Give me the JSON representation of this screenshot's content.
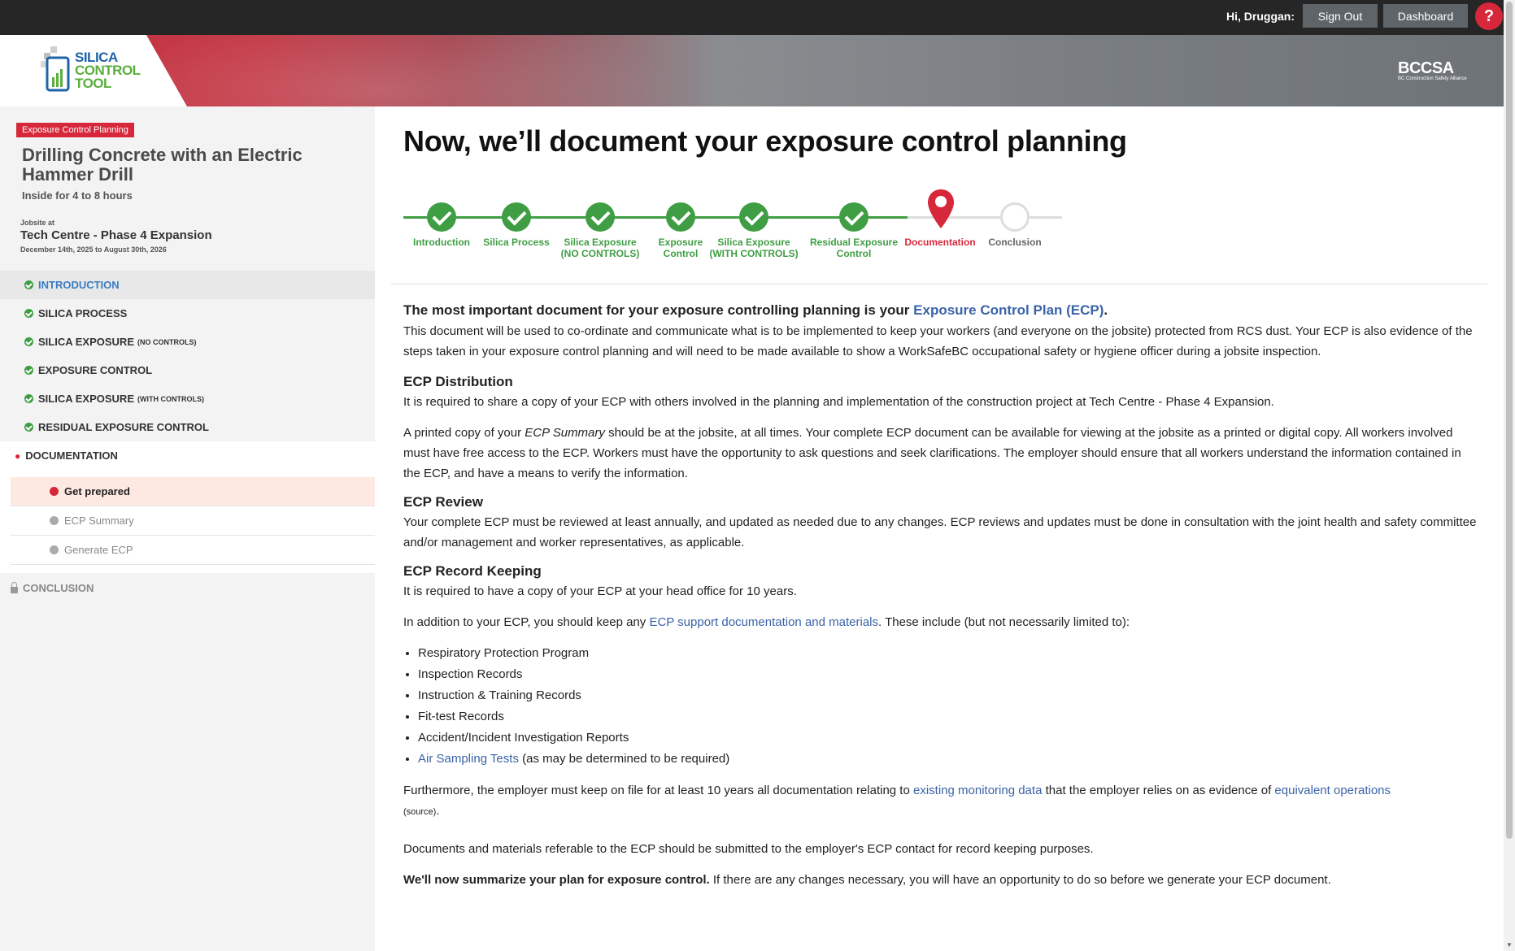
{
  "topbar": {
    "greeting": "Hi, Druggan:",
    "sign_out": "Sign Out",
    "dashboard": "Dashboard",
    "help": "?"
  },
  "banner": {
    "logo_line1": "SILICA",
    "logo_line2": "CONTROL",
    "logo_line3": "TOOL",
    "partner": "BCCSA",
    "partner_sub": "BC Construction Safety Alliance"
  },
  "sidebar": {
    "badge": "Exposure Control Planning",
    "task_title": "Drilling Concrete with an Electric Hammer Drill",
    "task_duration": "Inside for 4 to 8 hours",
    "jobsite_label": "Jobsite at",
    "jobsite_name": "Tech Centre - Phase 4 Expansion",
    "jobsite_dates": "December 14th, 2025 to August 30th, 2026",
    "nav": [
      {
        "label": "Introduction",
        "small": ""
      },
      {
        "label": "Silica Process",
        "small": ""
      },
      {
        "label": "Silica Exposure",
        "small": "(NO CONTROLS)"
      },
      {
        "label": "Exposure Control",
        "small": ""
      },
      {
        "label": "Silica Exposure",
        "small": "(WITH CONTROLS)"
      },
      {
        "label": "Residual Exposure Control",
        "small": ""
      },
      {
        "label": "Documentation",
        "small": ""
      },
      {
        "label": "Conclusion",
        "small": ""
      }
    ],
    "sub_items": [
      "Get prepared",
      "ECP Summary",
      "Generate ECP"
    ]
  },
  "main": {
    "heading": "Now, we’ll document your exposure control planning",
    "steps": [
      {
        "l1": "Introduction",
        "l2": ""
      },
      {
        "l1": "Silica Process",
        "l2": ""
      },
      {
        "l1": "Silica Exposure",
        "l2": "(NO CONTROLS)"
      },
      {
        "l1": "Exposure",
        "l2": "Control"
      },
      {
        "l1": "Silica Exposure",
        "l2": "(WITH CONTROLS)"
      },
      {
        "l1": "Residual Exposure",
        "l2": "Control"
      },
      {
        "l1": "Documentation",
        "l2": ""
      },
      {
        "l1": "Conclusion",
        "l2": ""
      }
    ],
    "intro_heading_pre": "The most important document for your exposure controlling planning is your ",
    "intro_heading_link": "Exposure Control Plan (ECP)",
    "intro_heading_post": ".",
    "intro_para": "This document will be used to co-ordinate and communicate what is to be implemented to keep your workers (and everyone on the jobsite) protected from RCS dust. Your ECP is also evidence of the steps taken in your exposure control planning and will need to be made available to show a WorkSafeBC occupational safety or hygiene officer during a jobsite inspection.",
    "dist_heading": "ECP Distribution",
    "dist_p1": "It is required to share a copy of your ECP with others involved in the planning and implementation of the construction project at Tech Centre - Phase 4 Expansion.",
    "dist_p2_pre": "A printed copy of your ",
    "dist_p2_em": "ECP Summary",
    "dist_p2_post": " should be at the jobsite, at all times. Your complete ECP document can be available for viewing at the jobsite as a printed or digital copy. All workers involved must have free access to the ECP. Workers must have the opportunity to ask questions and seek clarifications. The employer should ensure that all workers understand the information contained in the ECP, and have a means to verify the information.",
    "review_heading": "ECP Review",
    "review_p": "Your complete ECP must be reviewed at least annually, and updated as needed due to any changes. ECP reviews and updates must be done in consultation with the joint health and safety committee and/or management and worker representatives, as applicable.",
    "record_heading": "ECP Record Keeping",
    "record_p1": "It is required to have a copy of your ECP at your head office for 10 years.",
    "record_p2_pre": "In addition to your ECP, you should keep any ",
    "record_p2_link": "ECP support documentation and materials",
    "record_p2_post": ". These include (but not necessarily limited to):",
    "list": [
      "Respiratory Protection Program",
      "Inspection Records",
      "Instruction & Training Records",
      "Fit-test Records",
      "Accident/Incident Investigation Reports"
    ],
    "list_last_link": "Air Sampling Tests",
    "list_last_post": " (as may be determined to be required)",
    "further_pre": "Furthermore, the employer must keep on file for at least 10 years all documentation relating to ",
    "further_link1": "existing monitoring data",
    "further_mid": " that the employer relies on as evidence of ",
    "further_link2": "equivalent operations",
    "further_src": "(source)",
    "further_post": ".",
    "submit_p": "Documents and materials referable to the ECP should be submitted to the employer's ECP contact for record keeping purposes.",
    "final_bold": "We'll now summarize your plan for exposure control.",
    "final_post": " If there are any changes necessary, you will have an opportunity to do so before we generate your ECP document."
  }
}
